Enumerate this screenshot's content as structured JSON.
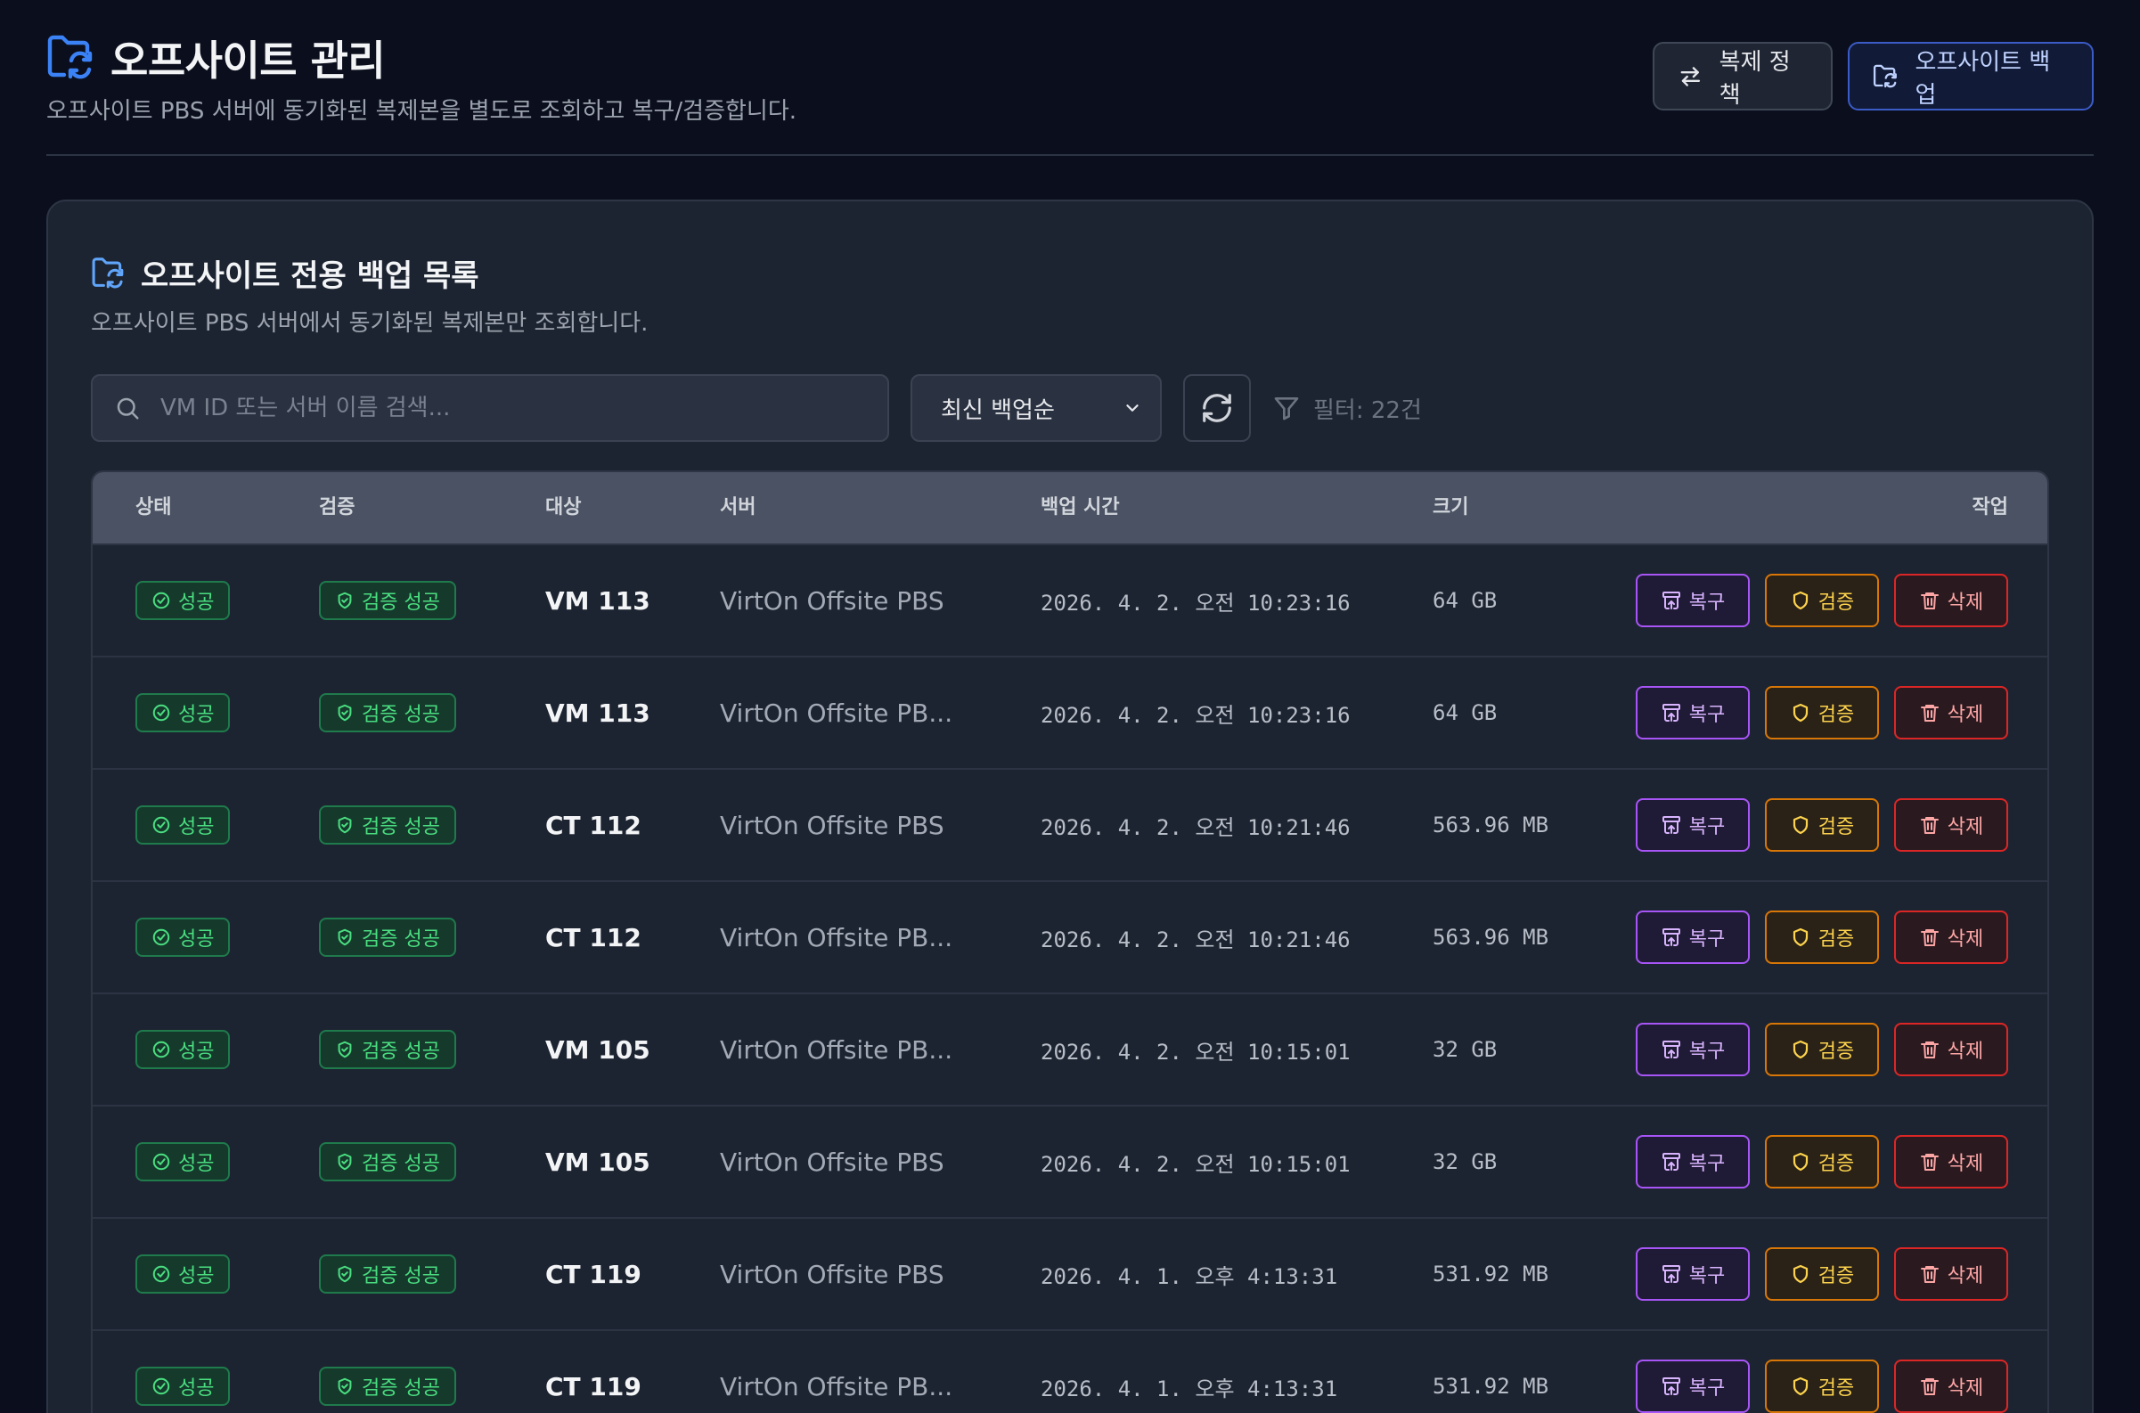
{
  "header": {
    "title": "오프사이트 관리",
    "subtitle": "오프사이트 PBS 서버에 동기화된 복제본을 별도로 조회하고 복구/검증합니다.",
    "policy_button": "복제 정책",
    "offsite_backup_button": "오프사이트 백업"
  },
  "card": {
    "title": "오프사이트 전용 백업 목록",
    "subtitle": "오프사이트 PBS 서버에서 동기화된 복제본만 조회합니다."
  },
  "toolbar": {
    "search_placeholder": "VM ID 또는 서버 이름 검색...",
    "sort_selected": "최신 백업순",
    "filter_text": "필터: 22건"
  },
  "table": {
    "columns": {
      "status": "상태",
      "verify": "검증",
      "target": "대상",
      "server": "서버",
      "time": "백업 시간",
      "size": "크기",
      "actions": "작업"
    },
    "rows": [
      {
        "status": "성공",
        "verify": "검증 성공",
        "target": "VM 113",
        "server": "VirtOn Offsite PBS",
        "time": "2026. 4. 2. 오전 10:23:16",
        "size": "64 GB"
      },
      {
        "status": "성공",
        "verify": "검증 성공",
        "target": "VM 113",
        "server": "VirtOn Offsite PB...",
        "time": "2026. 4. 2. 오전 10:23:16",
        "size": "64 GB"
      },
      {
        "status": "성공",
        "verify": "검증 성공",
        "target": "CT 112",
        "server": "VirtOn Offsite PBS",
        "time": "2026. 4. 2. 오전 10:21:46",
        "size": "563.96 MB"
      },
      {
        "status": "성공",
        "verify": "검증 성공",
        "target": "CT 112",
        "server": "VirtOn Offsite PB...",
        "time": "2026. 4. 2. 오전 10:21:46",
        "size": "563.96 MB"
      },
      {
        "status": "성공",
        "verify": "검증 성공",
        "target": "VM 105",
        "server": "VirtOn Offsite PB...",
        "time": "2026. 4. 2. 오전 10:15:01",
        "size": "32 GB"
      },
      {
        "status": "성공",
        "verify": "검증 성공",
        "target": "VM 105",
        "server": "VirtOn Offsite PBS",
        "time": "2026. 4. 2. 오전 10:15:01",
        "size": "32 GB"
      },
      {
        "status": "성공",
        "verify": "검증 성공",
        "target": "CT 119",
        "server": "VirtOn Offsite PBS",
        "time": "2026. 4. 1. 오후 4:13:31",
        "size": "531.92 MB"
      },
      {
        "status": "성공",
        "verify": "검증 성공",
        "target": "CT 119",
        "server": "VirtOn Offsite PB...",
        "time": "2026. 4. 1. 오후 4:13:31",
        "size": "531.92 MB"
      }
    ],
    "action_labels": {
      "restore": "복구",
      "verify": "검증",
      "delete": "삭제"
    }
  },
  "icons": {
    "title": "folder-sync-icon",
    "policy": "swap-arrows-icon",
    "search": "search-icon",
    "sort": "chevron-down-icon",
    "refresh": "refresh-icon",
    "filter": "filter-icon",
    "status": "check-circle-icon",
    "verify_badge": "shield-check-icon",
    "restore": "archive-restore-icon",
    "verify": "shield-icon",
    "delete": "trash-icon"
  },
  "colors": {
    "background": "#0b0f1d",
    "card": "#1d2431",
    "accent_blue": "#3b82f6",
    "success": "#4ade80",
    "restore": "#a855f7",
    "verify": "#f59e0b",
    "delete": "#ef4444"
  }
}
